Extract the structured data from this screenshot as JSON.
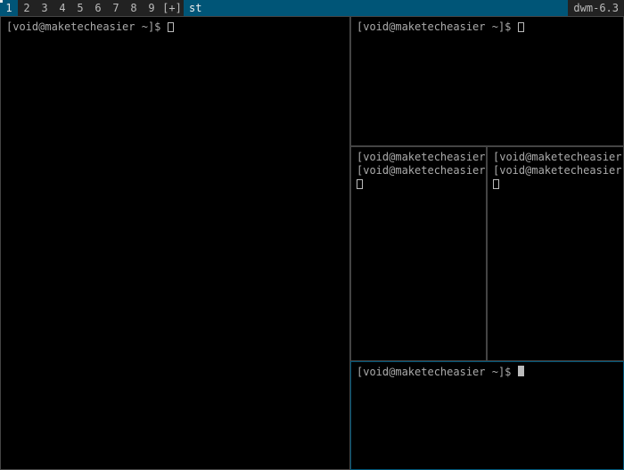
{
  "bar": {
    "tags": [
      "1",
      "2",
      "3",
      "4",
      "5",
      "6",
      "7",
      "8",
      "9"
    ],
    "selected_tag_index": 0,
    "layout_symbol": "[+]",
    "title": "st",
    "status": "dwm-6.3"
  },
  "prompt_text": "[void@maketecheasier ~]$ ",
  "terminals": {
    "master": {
      "lines": 1
    },
    "stack_top": {
      "lines": 1
    },
    "stack_mid_left": {
      "lines": 2
    },
    "stack_mid_right": {
      "lines": 2
    },
    "stack_bottom": {
      "lines": 1,
      "focused": true
    }
  }
}
